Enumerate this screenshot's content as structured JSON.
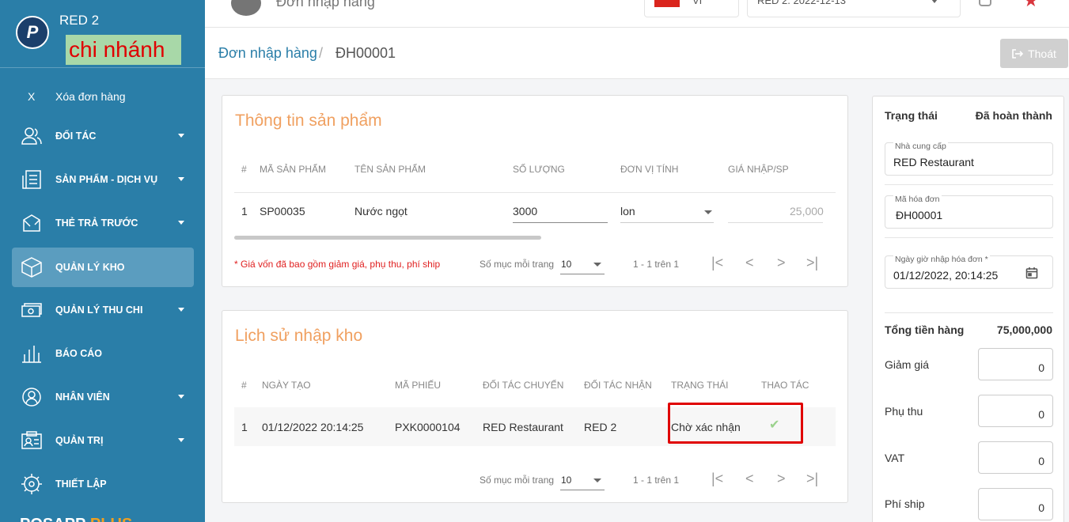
{
  "sidebar": {
    "logo_letter": "P",
    "branch_name": "RED 2",
    "branch_tag": "chi nhánh",
    "clear_x": "X",
    "clear_label": "Xóa đơn hàng",
    "items": [
      {
        "label": "ĐỐI TÁC",
        "icon": "partners-icon"
      },
      {
        "label": "SẢN PHẨM - DỊCH VỤ",
        "icon": "products-icon"
      },
      {
        "label": "THẺ TRẢ TRƯỚC",
        "icon": "prepaid-card-icon"
      },
      {
        "label": "QUẢN LÝ KHO",
        "icon": "warehouse-icon"
      },
      {
        "label": "QUẢN LÝ THU CHI",
        "icon": "cash-icon"
      },
      {
        "label": "BÁO CÁO",
        "icon": "report-icon"
      },
      {
        "label": "NHÂN VIÊN",
        "icon": "staff-icon"
      },
      {
        "label": "QUẢN TRỊ",
        "icon": "admin-icon"
      },
      {
        "label": "THIẾT LẬP",
        "icon": "settings-icon"
      }
    ],
    "footer_brand": "POSAPP",
    "footer_brand_suffix": "PLUS"
  },
  "topbar": {
    "title": "Đơn nhập hàng",
    "lang": "VI",
    "store": "RED 2. 2022-12-13"
  },
  "breadcrumb": {
    "link": "Đơn nhập hàng",
    "sep": "/",
    "current": "ĐH00001",
    "exit_label": "Thoát"
  },
  "products": {
    "title": "Thông tin sản phẩm",
    "headers": [
      "#",
      "MÃ SẢN PHẨM",
      "TÊN SẢN PHẨM",
      "SỐ LƯỢNG",
      "ĐƠN VỊ TÍNH",
      "GIÁ NHẬP/SP"
    ],
    "row": {
      "idx": "1",
      "code": "SP00035",
      "name": "Nước ngọt",
      "qty": "3000",
      "unit": "lon",
      "price": "25,000"
    },
    "note": "* Giá vốn đã bao gồm giảm giá, phụ thu, phí ship",
    "per_page_label": "Số mục mỗi trang",
    "per_page": "10",
    "range": "1 - 1 trên 1"
  },
  "history": {
    "title": "Lịch sử nhập kho",
    "headers": [
      "#",
      "NGÀY TẠO",
      "MÃ PHIẾU",
      "ĐỐI TÁC CHUYỂN",
      "ĐỐI TÁC NHẬN",
      "TRẠNG THÁI",
      "THAO TÁC"
    ],
    "row": {
      "idx": "1",
      "date": "01/12/2022 20:14:25",
      "code": "PXK0000104",
      "from": "RED Restaurant",
      "to": "RED 2",
      "status": "Chờ xác nhận"
    },
    "per_page_label": "Số mục mỗi trang",
    "per_page": "10",
    "range": "1 - 1 trên 1"
  },
  "summary": {
    "status_label": "Trạng thái",
    "status_value": "Đã hoàn thành",
    "supplier_label": "Nhà cung cấp",
    "supplier": "RED Restaurant",
    "invoice_label": "Mã hóa đơn",
    "invoice": "ĐH00001",
    "datetime_label": "Ngày giờ nhập hóa đơn *",
    "datetime": "01/12/2022, 20:14:25",
    "total_label": "Tổng tiền hàng",
    "total": "75,000,000",
    "discount_label": "Giảm giá",
    "discount": "0",
    "surcharge_label": "Phụ thu",
    "surcharge": "0",
    "vat_label": "VAT",
    "vat": "0",
    "ship_label": "Phí ship",
    "ship": "0"
  },
  "colors": {
    "sidebar": "#2a7ea8",
    "accent_title": "#f0a060",
    "highlight": "#e00000"
  }
}
